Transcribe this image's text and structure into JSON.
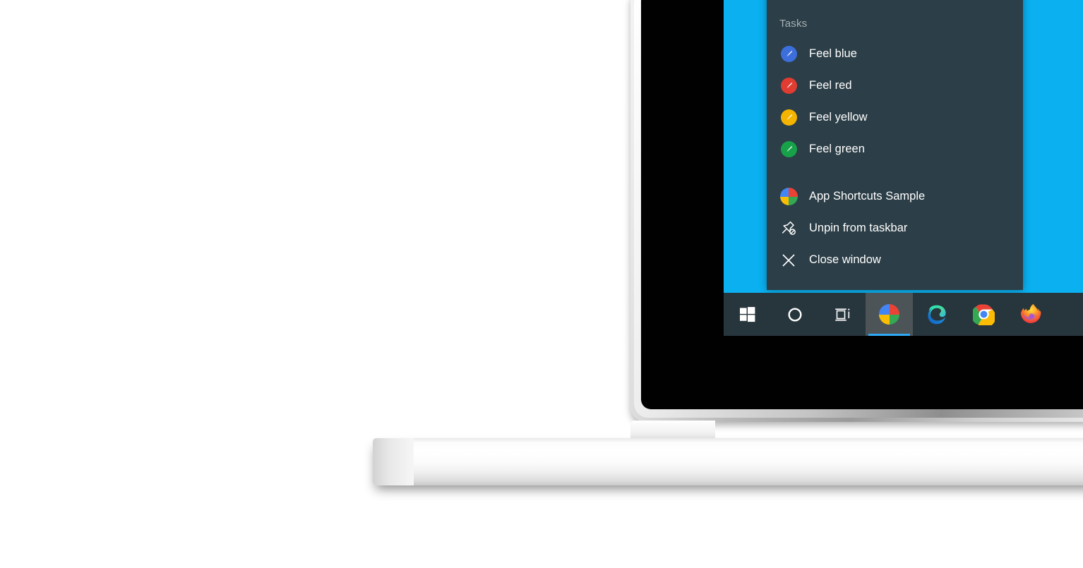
{
  "scene": {
    "description": "Windows 10 desktop on a laptop showing a taskbar jump list",
    "device": "laptop",
    "wallpaper_color": "#0ab0f0",
    "page_background": "#ffffff"
  },
  "jumplist": {
    "name": "app-shortcuts-jump-list",
    "background_color": "#2c3e47",
    "header": "Tasks",
    "header_color": "#a7b1b6",
    "tasks": [
      {
        "label": "Feel blue",
        "icon": "blue-brush-icon",
        "color": "#3d6fdc"
      },
      {
        "label": "Feel red",
        "icon": "red-brush-icon",
        "color": "#e03c31"
      },
      {
        "label": "Feel yellow",
        "icon": "yellow-brush-icon",
        "color": "#f5b400"
      },
      {
        "label": "Feel green",
        "icon": "green-brush-icon",
        "color": "#17a24a"
      }
    ],
    "actions": [
      {
        "label": "App Shortcuts Sample",
        "icon": "app-shortcuts-sample-icon"
      },
      {
        "label": "Unpin from taskbar",
        "icon": "unpin-icon"
      },
      {
        "label": "Close window",
        "icon": "close-icon"
      }
    ]
  },
  "taskbar": {
    "background_color": "#27353c",
    "active_highlight_color": "#4c5458",
    "active_underline_color": "#2fa8f5",
    "buttons": [
      {
        "name": "start-button",
        "icon": "windows-logo-icon",
        "active": false
      },
      {
        "name": "cortana-button",
        "icon": "cortana-circle-icon",
        "active": false
      },
      {
        "name": "task-view-button",
        "icon": "task-view-icon",
        "active": false
      },
      {
        "name": "app-shortcuts-sample-button",
        "icon": "app-shortcuts-sample-icon",
        "active": true
      },
      {
        "name": "edge-button",
        "icon": "microsoft-edge-icon",
        "active": false
      },
      {
        "name": "chrome-button",
        "icon": "google-chrome-icon",
        "active": false
      },
      {
        "name": "firefox-button",
        "icon": "mozilla-firefox-icon",
        "active": false
      }
    ]
  },
  "app_icon_quadrants": {
    "top_left": "#4285f4",
    "top_right": "#ea4335",
    "bottom_left": "#fbbc05",
    "bottom_right": "#34a853"
  }
}
